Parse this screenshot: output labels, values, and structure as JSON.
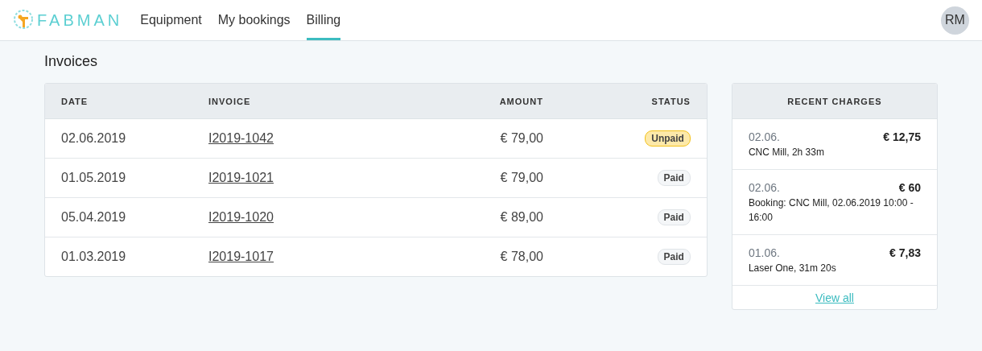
{
  "header": {
    "logo": "FABMAN",
    "tabs": [
      {
        "label": "Equipment",
        "selected": false
      },
      {
        "label": "My bookings",
        "selected": false
      },
      {
        "label": "Billing",
        "selected": true
      }
    ],
    "avatar": "RM"
  },
  "page_title": "Invoices",
  "invoices": {
    "columns": [
      "DATE",
      "INVOICE",
      "AMOUNT",
      "STATUS"
    ],
    "rows": [
      {
        "date": "02.06.2019",
        "invoice": "I2019-1042",
        "amount": "€ 79,00",
        "status": "Unpaid",
        "kind": "unpaid"
      },
      {
        "date": "01.05.2019",
        "invoice": "I2019-1021",
        "amount": "€ 79,00",
        "status": "Paid",
        "kind": "paid"
      },
      {
        "date": "05.04.2019",
        "invoice": "I2019-1020",
        "amount": "€ 89,00",
        "status": "Paid",
        "kind": "paid"
      },
      {
        "date": "01.03.2019",
        "invoice": "I2019-1017",
        "amount": "€ 78,00",
        "status": "Paid",
        "kind": "paid"
      }
    ]
  },
  "recent_charges": {
    "title": "RECENT CHARGES",
    "items": [
      {
        "date": "02.06.",
        "amount": "€ 12,75",
        "description": "CNC Mill, 2h 33m"
      },
      {
        "date": "02.06.",
        "amount": "€ 60",
        "description": "Booking: CNC Mill, 02.06.2019 10:00 - 16:00"
      },
      {
        "date": "01.06.",
        "amount": "€ 7,83",
        "description": "Laser One, 31m 20s"
      }
    ],
    "link": "View all"
  }
}
